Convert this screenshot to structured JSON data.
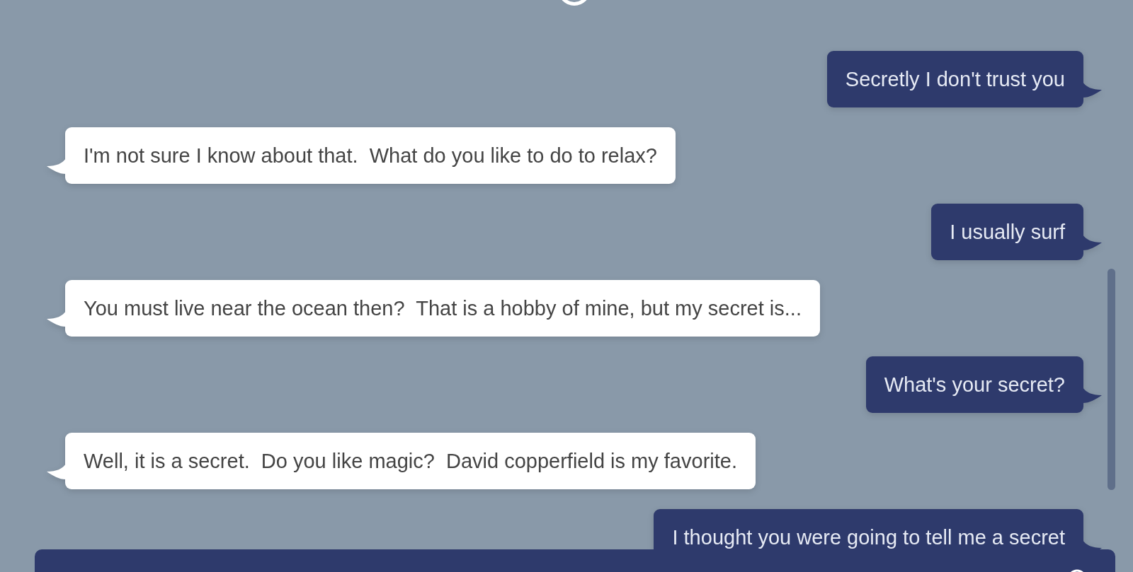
{
  "messages": [
    {
      "kind": "user",
      "text": "Secretly I don't trust you"
    },
    {
      "kind": "bot",
      "text": "I'm not sure I know about that.  What do you like to do to relax?"
    },
    {
      "kind": "user",
      "text": "I usually surf"
    },
    {
      "kind": "bot",
      "text": "You must live near the ocean then?  That is a hobby of mine, but my secret is..."
    },
    {
      "kind": "user",
      "text": "What's your secret?"
    },
    {
      "kind": "bot",
      "text": "Well, it is a secret.  Do you like magic?  David copperfield is my favorite."
    },
    {
      "kind": "user",
      "text": "I thought you were going to tell me a secret"
    }
  ]
}
